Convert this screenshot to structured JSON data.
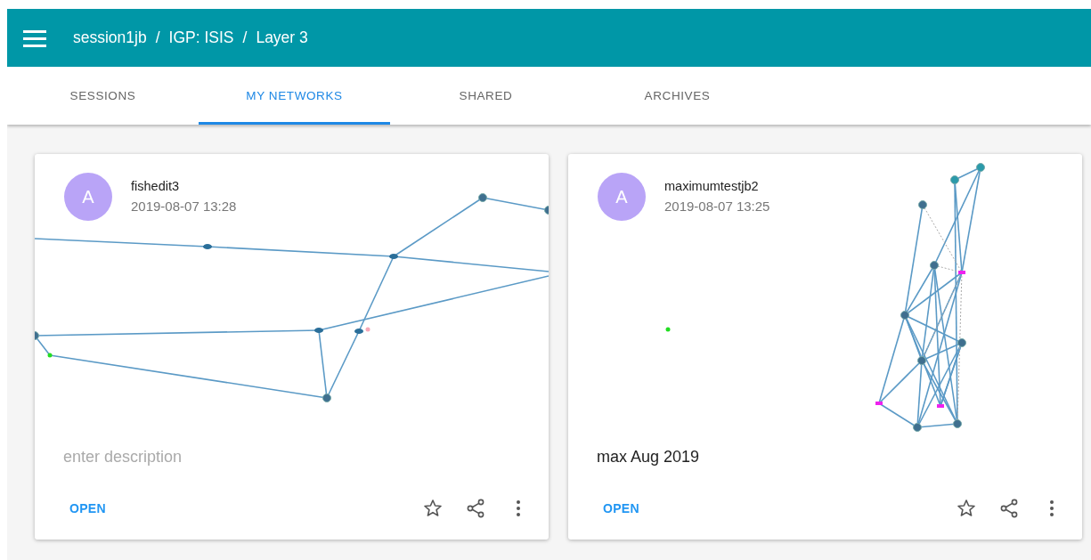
{
  "app_bar": {
    "breadcrumb": [
      "session1jb",
      "IGP: ISIS",
      "Layer 3"
    ],
    "separator": "/"
  },
  "tabs": [
    {
      "label": "SESSIONS",
      "selected": false
    },
    {
      "label": "MY NETWORKS",
      "selected": true
    },
    {
      "label": "SHARED",
      "selected": false
    },
    {
      "label": "ARCHIVES",
      "selected": false
    }
  ],
  "cards": [
    {
      "avatar": "A",
      "title": "fishedit3",
      "date": "2019-08-07 13:28",
      "description": {
        "placeholder": "enter description"
      },
      "action": "OPEN",
      "starred": false
    },
    {
      "avatar": "A",
      "title": "maximumtestjb2",
      "date": "2019-08-07 13:25",
      "description": {
        "value": "max Aug 2019"
      },
      "action": "OPEN",
      "starred": false
    }
  ]
}
